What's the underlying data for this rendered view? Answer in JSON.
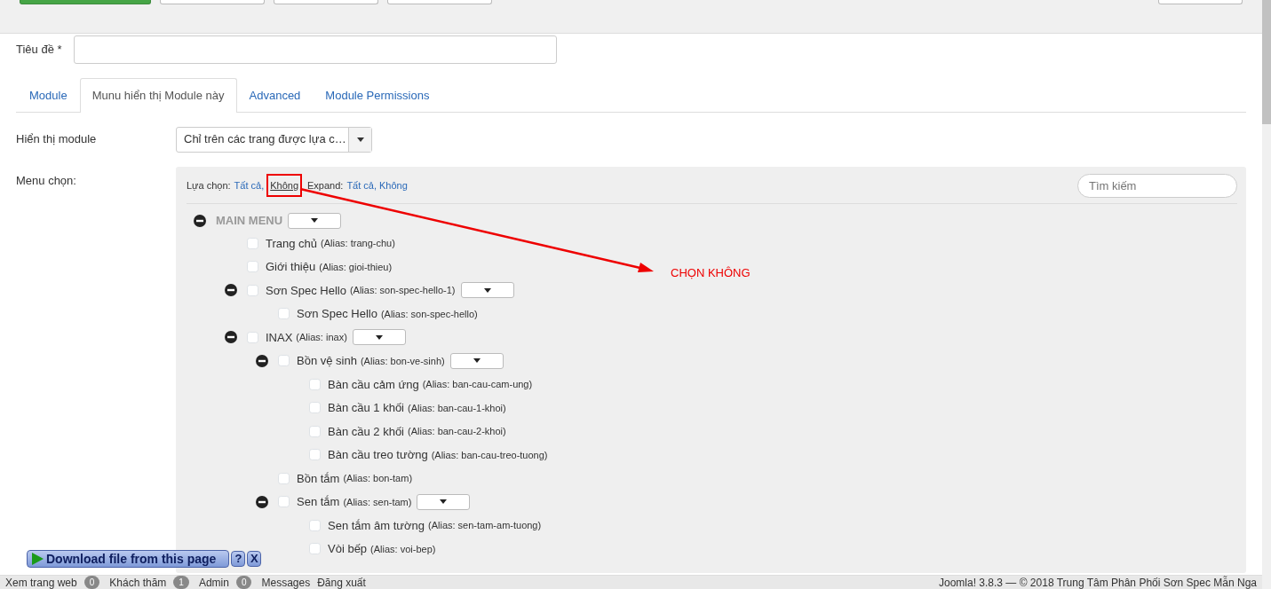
{
  "toolbar": {
    "buttons": [
      {
        "kind": "success"
      },
      {
        "kind": "default"
      },
      {
        "kind": "default"
      },
      {
        "kind": "default"
      },
      {
        "kind": "right"
      }
    ]
  },
  "title_field": {
    "label": "Tiêu đề *"
  },
  "tabs": [
    {
      "label": "Module",
      "selected": false
    },
    {
      "label": "Munu hiển thị Module này",
      "selected": true
    },
    {
      "label": "Advanced",
      "selected": false
    },
    {
      "label": "Module Permissions",
      "selected": false
    }
  ],
  "display_module": {
    "label": "Hiển thị module",
    "value": "Chỉ trên các trang được lựa c…"
  },
  "menu_select": {
    "label": "Menu chọn:",
    "select_label": "Lựa chọn:",
    "select_links": [
      {
        "text": "Tất cả,",
        "highlighted": false
      },
      {
        "text": "Không",
        "highlighted": true
      }
    ],
    "expand_label": "Expand:",
    "expand_links": [
      {
        "text": "Tất cả,",
        "highlighted": false
      },
      {
        "text": "Không",
        "highlighted": false
      }
    ],
    "search": {
      "placeholder": "Tìm kiếm"
    },
    "tree": [
      {
        "label": "MAIN MENU",
        "kind": "menu",
        "expanded": true,
        "children": [
          {
            "label": "Trang chủ",
            "alias": "(Alias: trang-chu)",
            "checked": false
          },
          {
            "label": "Giới thiệu",
            "alias": "(Alias: gioi-thieu)",
            "checked": false
          },
          {
            "label": "Sơn Spec Hello",
            "alias": "(Alias: son-spec-hello-1)",
            "checked": false,
            "expanded": true,
            "children": [
              {
                "label": "Sơn Spec Hello",
                "alias": "(Alias: son-spec-hello)",
                "checked": false
              }
            ]
          },
          {
            "label": "INAX",
            "alias": "(Alias: inax)",
            "checked": false,
            "expanded": true,
            "children": [
              {
                "label": "Bồn vệ sinh",
                "alias": "(Alias: bon-ve-sinh)",
                "checked": false,
                "expanded": true,
                "children": [
                  {
                    "label": "Bàn cầu cảm ứng",
                    "alias": "(Alias: ban-cau-cam-ung)",
                    "checked": false
                  },
                  {
                    "label": "Bàn cầu 1 khối",
                    "alias": "(Alias: ban-cau-1-khoi)",
                    "checked": false
                  },
                  {
                    "label": "Bàn cầu 2 khối",
                    "alias": "(Alias: ban-cau-2-khoi)",
                    "checked": false
                  },
                  {
                    "label": "Bàn cầu treo tường",
                    "alias": "(Alias: ban-cau-treo-tuong)",
                    "checked": false
                  }
                ]
              },
              {
                "label": "Bồn tắm",
                "alias": "(Alias: bon-tam)",
                "checked": false
              },
              {
                "label": "Sen tắm",
                "alias": "(Alias: sen-tam)",
                "checked": false,
                "expanded": true,
                "children": [
                  {
                    "label": "Sen tắm âm tường",
                    "alias": "(Alias: sen-tam-am-tuong)",
                    "checked": false
                  },
                  {
                    "label": "Vòi bếp",
                    "alias": "(Alias: voi-bep)",
                    "checked": false
                  }
                ]
              }
            ]
          }
        ]
      }
    ]
  },
  "annotation": {
    "text": "CHỌN KHÔNG"
  },
  "download_bar": {
    "label": "Download file from this page",
    "help": "?",
    "close": "X"
  },
  "status_bar": {
    "left": [
      {
        "kind": "link",
        "text": "Xem trang web"
      },
      {
        "kind": "count",
        "count": "0",
        "text": "Khách thăm"
      },
      {
        "kind": "count",
        "count": "1",
        "text": "Admin"
      },
      {
        "kind": "count",
        "count": "0",
        "text": "Messages"
      },
      {
        "kind": "link",
        "text": "Đăng xuất"
      }
    ],
    "right": "Joomla! 3.8.3 — © 2018 Trung Tâm Phân Phối Sơn Spec Mẫn Nga"
  }
}
